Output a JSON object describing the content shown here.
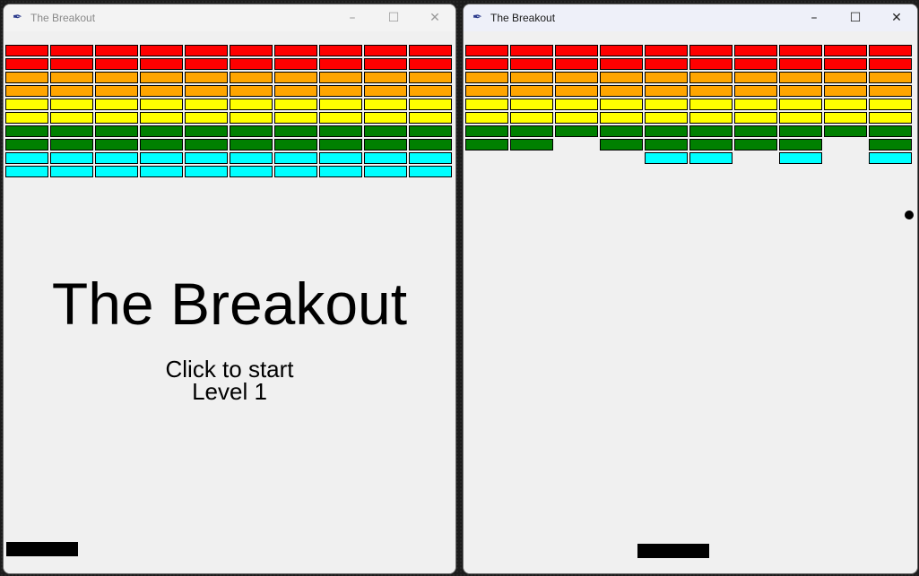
{
  "colors": {
    "red": "#ff0000",
    "orange": "#ffa500",
    "yellow": "#ffff00",
    "green": "#008000",
    "cyan": "#00ffff",
    "paddle": "#000000",
    "ball": "#000000"
  },
  "brick_row_colors": [
    "red",
    "red",
    "orange",
    "orange",
    "yellow",
    "yellow",
    "green",
    "green",
    "cyan",
    "cyan"
  ],
  "left_window": {
    "title": "The Breakout",
    "app_icon": "feather-icon",
    "controls": {
      "minimize": "–",
      "maximize": "☐",
      "close": "✕"
    },
    "game_title": "The Breakout",
    "prompt": "Click to start",
    "level": "Level 1",
    "bricks": [
      [
        1,
        1,
        1,
        1,
        1,
        1,
        1,
        1,
        1,
        1
      ],
      [
        1,
        1,
        1,
        1,
        1,
        1,
        1,
        1,
        1,
        1
      ],
      [
        1,
        1,
        1,
        1,
        1,
        1,
        1,
        1,
        1,
        1
      ],
      [
        1,
        1,
        1,
        1,
        1,
        1,
        1,
        1,
        1,
        1
      ],
      [
        1,
        1,
        1,
        1,
        1,
        1,
        1,
        1,
        1,
        1
      ],
      [
        1,
        1,
        1,
        1,
        1,
        1,
        1,
        1,
        1,
        1
      ],
      [
        1,
        1,
        1,
        1,
        1,
        1,
        1,
        1,
        1,
        1
      ],
      [
        1,
        1,
        1,
        1,
        1,
        1,
        1,
        1,
        1,
        1
      ],
      [
        1,
        1,
        1,
        1,
        1,
        1,
        1,
        1,
        1,
        1
      ],
      [
        1,
        1,
        1,
        1,
        1,
        1,
        1,
        1,
        1,
        1
      ]
    ]
  },
  "right_window": {
    "title": "The Breakout",
    "app_icon": "feather-icon",
    "controls": {
      "minimize": "–",
      "maximize": "☐",
      "close": "✕"
    },
    "bricks": [
      [
        1,
        1,
        1,
        1,
        1,
        1,
        1,
        1,
        1,
        1
      ],
      [
        1,
        1,
        1,
        1,
        1,
        1,
        1,
        1,
        1,
        1
      ],
      [
        1,
        1,
        1,
        1,
        1,
        1,
        1,
        1,
        1,
        1
      ],
      [
        1,
        1,
        1,
        1,
        1,
        1,
        1,
        1,
        1,
        1
      ],
      [
        1,
        1,
        1,
        1,
        1,
        1,
        1,
        1,
        1,
        1
      ],
      [
        1,
        1,
        1,
        1,
        1,
        1,
        1,
        1,
        1,
        1
      ],
      [
        1,
        1,
        1,
        1,
        1,
        1,
        1,
        1,
        1,
        1
      ],
      [
        1,
        1,
        0,
        1,
        1,
        1,
        1,
        1,
        0,
        1
      ],
      [
        0,
        0,
        0,
        0,
        1,
        1,
        0,
        1,
        0,
        1
      ],
      [
        0,
        0,
        0,
        0,
        0,
        0,
        0,
        0,
        0,
        0
      ]
    ]
  }
}
